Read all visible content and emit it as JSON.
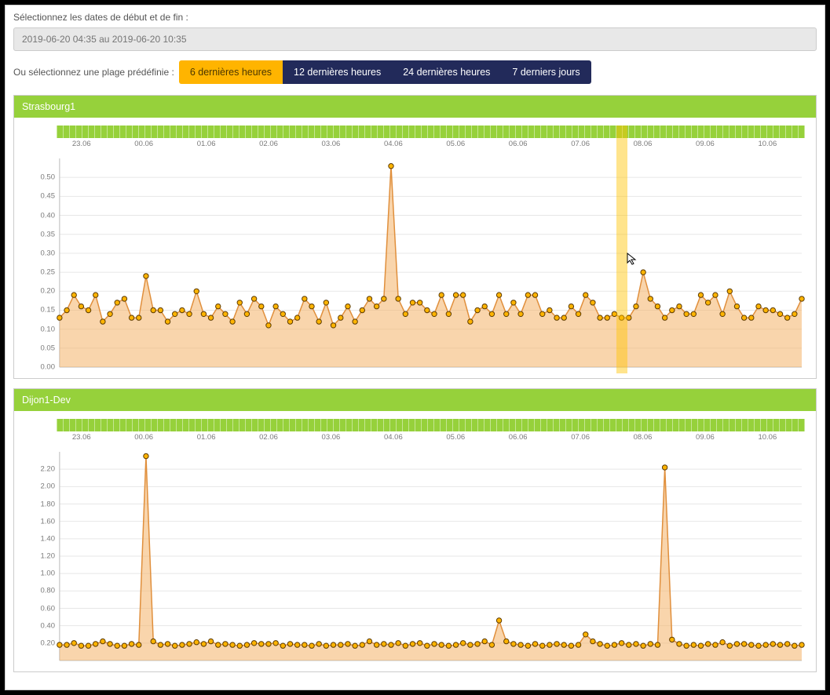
{
  "dateSelectLabel": "Sélectionnez les dates de début et de fin :",
  "dateInputValue": "2019-06-20 04:35 au 2019-06-20 10:35",
  "rangeLabel": "Ou sélectionnez une plage prédéfinie :",
  "rangeButtons": [
    {
      "label": "6 dernières heures",
      "active": true
    },
    {
      "label": "12 dernières heures",
      "active": false
    },
    {
      "label": "24 dernières heures",
      "active": false
    },
    {
      "label": "7 derniers jours",
      "active": false
    }
  ],
  "xTicks": [
    "23.06",
    "00.06",
    "01.06",
    "02.06",
    "03.06",
    "04.06",
    "05.06",
    "06.06",
    "07.06",
    "08.06",
    "09.06",
    "10.06"
  ],
  "chart_data": [
    {
      "type": "line",
      "title": "Strasbourg1",
      "ylim": [
        0,
        0.55
      ],
      "yTicks": [
        0.0,
        0.05,
        0.1,
        0.15,
        0.2,
        0.25,
        0.3,
        0.35,
        0.4,
        0.45,
        0.5
      ],
      "highlight_x_index": 78,
      "values": [
        0.13,
        0.15,
        0.19,
        0.16,
        0.15,
        0.19,
        0.12,
        0.14,
        0.17,
        0.18,
        0.13,
        0.13,
        0.24,
        0.15,
        0.15,
        0.12,
        0.14,
        0.15,
        0.14,
        0.2,
        0.14,
        0.13,
        0.16,
        0.14,
        0.12,
        0.17,
        0.14,
        0.18,
        0.16,
        0.11,
        0.16,
        0.14,
        0.12,
        0.13,
        0.18,
        0.16,
        0.12,
        0.17,
        0.11,
        0.13,
        0.16,
        0.12,
        0.15,
        0.18,
        0.16,
        0.18,
        0.53,
        0.18,
        0.14,
        0.17,
        0.17,
        0.15,
        0.14,
        0.19,
        0.14,
        0.19,
        0.19,
        0.12,
        0.15,
        0.16,
        0.14,
        0.19,
        0.14,
        0.17,
        0.14,
        0.19,
        0.19,
        0.14,
        0.15,
        0.13,
        0.13,
        0.16,
        0.14,
        0.19,
        0.17,
        0.13,
        0.13,
        0.14,
        0.13,
        0.13,
        0.16,
        0.25,
        0.18,
        0.16,
        0.13,
        0.15,
        0.16,
        0.14,
        0.14,
        0.19,
        0.17,
        0.19,
        0.14,
        0.2,
        0.16,
        0.13,
        0.13,
        0.16,
        0.15,
        0.15,
        0.14,
        0.13,
        0.14,
        0.18
      ]
    },
    {
      "type": "line",
      "title": "Dijon1-Dev",
      "ylim": [
        0,
        2.4
      ],
      "yTicks": [
        0.2,
        0.4,
        0.6,
        0.8,
        1.0,
        1.2,
        1.4,
        1.6,
        1.8,
        2.0,
        2.2
      ],
      "values": [
        0.18,
        0.18,
        0.2,
        0.17,
        0.17,
        0.19,
        0.22,
        0.19,
        0.17,
        0.17,
        0.19,
        0.18,
        2.35,
        0.22,
        0.18,
        0.19,
        0.17,
        0.18,
        0.19,
        0.21,
        0.19,
        0.22,
        0.18,
        0.19,
        0.18,
        0.17,
        0.18,
        0.2,
        0.19,
        0.19,
        0.2,
        0.17,
        0.19,
        0.18,
        0.18,
        0.17,
        0.19,
        0.17,
        0.18,
        0.18,
        0.19,
        0.17,
        0.18,
        0.22,
        0.18,
        0.19,
        0.18,
        0.2,
        0.17,
        0.19,
        0.2,
        0.17,
        0.19,
        0.18,
        0.17,
        0.18,
        0.2,
        0.18,
        0.19,
        0.22,
        0.18,
        0.46,
        0.22,
        0.19,
        0.18,
        0.17,
        0.19,
        0.17,
        0.18,
        0.19,
        0.18,
        0.17,
        0.18,
        0.3,
        0.22,
        0.19,
        0.17,
        0.18,
        0.2,
        0.18,
        0.19,
        0.17,
        0.19,
        0.18,
        2.22,
        0.24,
        0.19,
        0.17,
        0.18,
        0.17,
        0.19,
        0.18,
        0.21,
        0.17,
        0.19,
        0.19,
        0.18,
        0.17,
        0.18,
        0.19,
        0.18,
        0.19,
        0.17,
        0.18
      ]
    }
  ],
  "colors": {
    "green": "#96d13b",
    "navy": "#222a5a",
    "orange": "#ffb400",
    "areaFill": "rgba(244,179,104,0.55)",
    "areaStroke": "#e08f3c",
    "point": "#c97a2c"
  }
}
